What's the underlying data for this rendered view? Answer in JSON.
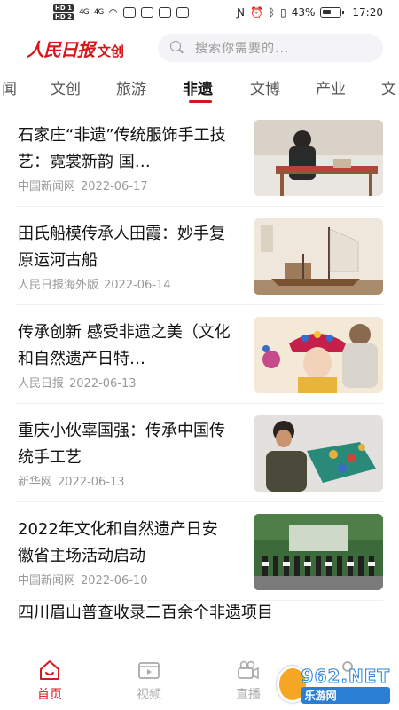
{
  "status_bar": {
    "hd1": "HD 1",
    "hd2": "HD 2",
    "signal1": "4G",
    "signal2": "4G",
    "battery_pct": "43%",
    "time": "17:20"
  },
  "header": {
    "logo_main": "人民日报",
    "logo_sub": "文创",
    "search_placeholder": "搜索你需要的..."
  },
  "tabs": [
    {
      "label": "闻"
    },
    {
      "label": "文创"
    },
    {
      "label": "旅游"
    },
    {
      "label": "非遗",
      "active": true
    },
    {
      "label": "文博"
    },
    {
      "label": "产业"
    },
    {
      "label": "文"
    }
  ],
  "news": [
    {
      "title": "石家庄“非遗”传统服饰手工技艺：霓裳新韵 国…",
      "source": "中国新闻网",
      "date": "2022-06-17",
      "thumb": "tailor-at-table"
    },
    {
      "title": "田氏船模传承人田霞：妙手复原运河古船",
      "source": "人民日报海外版",
      "date": "2022-06-14",
      "thumb": "ship-model"
    },
    {
      "title": "传承创新 感受非遗之美（文化和自然遗产日特…",
      "source": "人民日报",
      "date": "2022-06-13",
      "thumb": "child-opera-headdress"
    },
    {
      "title": "重庆小伙辜国强：传承中国传统手工艺",
      "source": "新华网",
      "date": "2022-06-13",
      "thumb": "craftsman-with-lantern"
    },
    {
      "title": "2022年文化和自然遗产日安徽省主场活动启动",
      "source": "中国新闻网",
      "date": "2022-06-10",
      "thumb": "stage-ceremony"
    }
  ],
  "partial_item": {
    "title": "四川眉山普查收录二百余个非遗项目"
  },
  "bottom_nav": [
    {
      "label": "首页",
      "icon": "home-icon",
      "active": true
    },
    {
      "label": "视频",
      "icon": "video-icon"
    },
    {
      "label": "直播",
      "icon": "live-camera-icon"
    },
    {
      "label": "",
      "icon": "profile-icon"
    }
  ],
  "watermark": {
    "top": "962.NET",
    "bottom": "乐游网"
  },
  "colors": {
    "accent": "#d8161c",
    "text": "#111111",
    "meta": "#999999"
  }
}
